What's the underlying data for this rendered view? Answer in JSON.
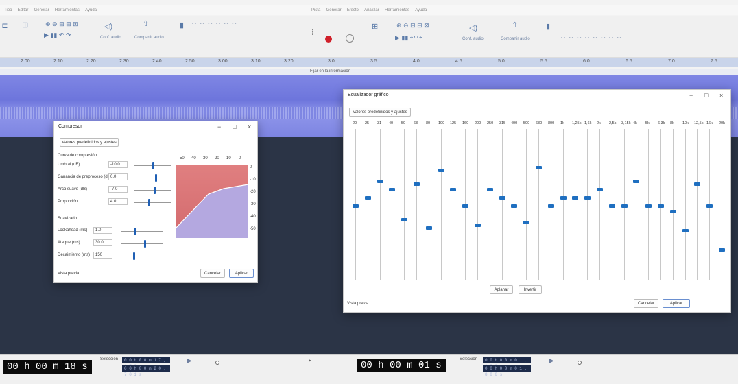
{
  "left": {
    "menu": [
      "Tipo",
      "Editar",
      "Generar",
      "Herramientas",
      "Ayuda"
    ],
    "toolbar": {
      "share_label": "Compartir audio",
      "audio_label": "Conf. audio"
    },
    "ruler": [
      "2:00",
      "2:10",
      "2:20",
      "2:30",
      "2:40",
      "2:50",
      "3:00",
      "3:10",
      "3:20"
    ],
    "time_display": "00 h 00 m 18 s",
    "selection_label": "Selección",
    "selection_start": "0 0 h 0 0 m 1 7 , 1 7 2 s",
    "selection_end": "0 0 h 0 0 m 2 0 , 7 0 1 s",
    "compressor": {
      "title": "Compresor",
      "presets_button": "Valores predefinidos y ajustes",
      "section_curve": "Curva de compresión",
      "rows": [
        {
          "label": "Umbral (dB)",
          "value": "-10.0"
        },
        {
          "label": "Ganancia de preproceso (dB)",
          "value": "0.0"
        },
        {
          "label": "Arco suave (dB)",
          "value": "-7.0"
        },
        {
          "label": "Proporción",
          "value": "4.0"
        }
      ],
      "section_smoothing": "Suavizado",
      "rows2": [
        {
          "label": "Lookahead (ms)",
          "value": "1.0"
        },
        {
          "label": "Ataque (ms)",
          "value": "30.0"
        },
        {
          "label": "Decaimiento (ms)",
          "value": "150"
        }
      ],
      "db_top": [
        "-50",
        "-40",
        "-30",
        "-20",
        "-10",
        "0"
      ],
      "db_side": [
        "0",
        "-10",
        "-20",
        "-30",
        "-40",
        "-50"
      ],
      "preview_button": "Vista previa",
      "cancel_button": "Cancelar",
      "apply_button": "Aplicar"
    }
  },
  "right": {
    "menu": [
      "Pista",
      "Generar",
      "Efecto",
      "Analizar",
      "Herramientas",
      "Ayuda"
    ],
    "toolbar": {
      "share_label": "Compartir audio",
      "audio_label": "Conf. audio"
    },
    "ruler": [
      "3.0",
      "3.5",
      "4.0",
      "4.5",
      "5.0",
      "5.5",
      "6.0",
      "6.5",
      "7.0",
      "7.5"
    ],
    "clip_label": "Fijar en la información",
    "time_display": "00 h 00 m 01 s",
    "selection_label": "Selección",
    "selection_start": "0 0 h 0 0 m 0 1 , 2 8 2 s",
    "selection_end": "0 0 h 0 0 m 0 1 , 8 0 0 s",
    "eq": {
      "title": "Ecualizador gráfico",
      "presets_button": "Valores predefinidos y ajustes",
      "bands": [
        "20",
        "25",
        "31",
        "40",
        "50",
        "63",
        "80",
        "100",
        "125",
        "160",
        "200",
        "250",
        "315",
        "400",
        "500",
        "630",
        "800",
        "1k",
        "1,25k",
        "1,6k",
        "2k",
        "2,5k",
        "3,15k",
        "4k",
        "5k",
        "6,3k",
        "8k",
        "10k",
        "12,5k",
        "16k",
        "20k"
      ],
      "band_levels": [
        0.0,
        1.5,
        4.5,
        3.0,
        -2.5,
        4.0,
        -4.0,
        6.5,
        3.0,
        0.0,
        -3.5,
        3.0,
        1.5,
        0.0,
        -3.0,
        7.0,
        0.0,
        1.5,
        1.5,
        1.5,
        3.0,
        0.0,
        0.0,
        4.5,
        0.0,
        0.0,
        -1.0,
        -4.5,
        4.0,
        0.0,
        -8.0
      ],
      "flatten_button": "Aplanar",
      "invert_button": "Invertir",
      "preview_button": "Vista previa",
      "cancel_button": "Cancelar",
      "apply_button": "Aplicar"
    }
  }
}
